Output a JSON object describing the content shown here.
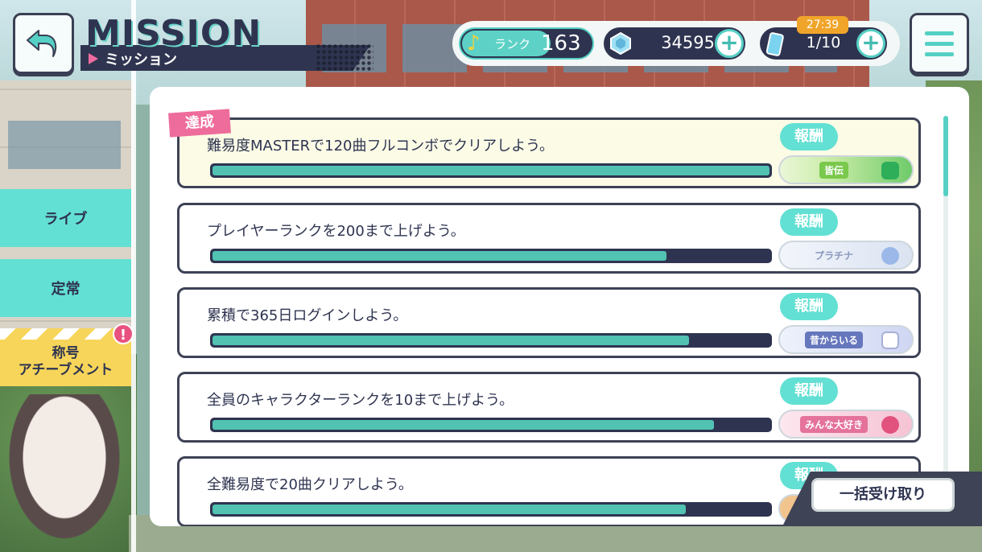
{
  "header": {
    "title": "MISSION",
    "subtitle": "ミッション"
  },
  "status": {
    "rank_label": "ランク",
    "rank_value": "163",
    "gems": "34595",
    "stamina": "1/10",
    "stamina_timer": "27:39"
  },
  "tabs": [
    {
      "label": "ライブ"
    },
    {
      "label": "定常"
    },
    {
      "label_line1": "称号",
      "label_line2": "アチーブメント",
      "alert": "!"
    }
  ],
  "reward_label": "報酬",
  "achieved_label": "達成",
  "missions": [
    {
      "text": "難易度MASTERで120曲フルコンボでクリアしよう。",
      "progress": 1.0,
      "reward": "皆伝",
      "achieved": true
    },
    {
      "text": "プレイヤーランクを200まで上げよう。",
      "progress": 0.815,
      "reward": "プラチナ",
      "achieved": false
    },
    {
      "text": "累積で365日ログインしよう。",
      "progress": 0.855,
      "reward": "昔からいる",
      "achieved": false
    },
    {
      "text": "全員のキャラクターランクを10まで上げよう。",
      "progress": 0.9,
      "reward": "みんな大好き",
      "achieved": false
    },
    {
      "text": "全難易度で20曲クリアしよう。",
      "progress": 0.85,
      "reward": "",
      "achieved": false
    }
  ],
  "claim_all_label": "一括受け取り",
  "colors": {
    "accent": "#56d0c4",
    "navy": "#2e3450",
    "pink": "#ee6c9b",
    "yellow": "#f7d55a"
  }
}
